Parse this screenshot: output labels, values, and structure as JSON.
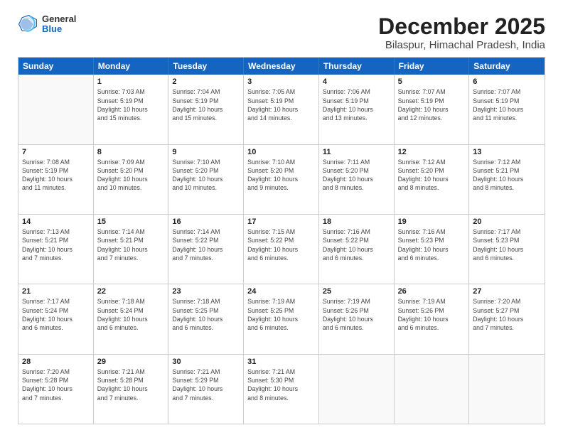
{
  "header": {
    "logo": {
      "general": "General",
      "blue": "Blue"
    },
    "title": "December 2025",
    "subtitle": "Bilaspur, Himachal Pradesh, India"
  },
  "calendar": {
    "days_of_week": [
      "Sunday",
      "Monday",
      "Tuesday",
      "Wednesday",
      "Thursday",
      "Friday",
      "Saturday"
    ],
    "rows": [
      [
        {
          "day": "",
          "info": ""
        },
        {
          "day": "1",
          "info": "Sunrise: 7:03 AM\nSunset: 5:19 PM\nDaylight: 10 hours\nand 15 minutes."
        },
        {
          "day": "2",
          "info": "Sunrise: 7:04 AM\nSunset: 5:19 PM\nDaylight: 10 hours\nand 15 minutes."
        },
        {
          "day": "3",
          "info": "Sunrise: 7:05 AM\nSunset: 5:19 PM\nDaylight: 10 hours\nand 14 minutes."
        },
        {
          "day": "4",
          "info": "Sunrise: 7:06 AM\nSunset: 5:19 PM\nDaylight: 10 hours\nand 13 minutes."
        },
        {
          "day": "5",
          "info": "Sunrise: 7:07 AM\nSunset: 5:19 PM\nDaylight: 10 hours\nand 12 minutes."
        },
        {
          "day": "6",
          "info": "Sunrise: 7:07 AM\nSunset: 5:19 PM\nDaylight: 10 hours\nand 11 minutes."
        }
      ],
      [
        {
          "day": "7",
          "info": "Sunrise: 7:08 AM\nSunset: 5:19 PM\nDaylight: 10 hours\nand 11 minutes."
        },
        {
          "day": "8",
          "info": "Sunrise: 7:09 AM\nSunset: 5:20 PM\nDaylight: 10 hours\nand 10 minutes."
        },
        {
          "day": "9",
          "info": "Sunrise: 7:10 AM\nSunset: 5:20 PM\nDaylight: 10 hours\nand 10 minutes."
        },
        {
          "day": "10",
          "info": "Sunrise: 7:10 AM\nSunset: 5:20 PM\nDaylight: 10 hours\nand 9 minutes."
        },
        {
          "day": "11",
          "info": "Sunrise: 7:11 AM\nSunset: 5:20 PM\nDaylight: 10 hours\nand 8 minutes."
        },
        {
          "day": "12",
          "info": "Sunrise: 7:12 AM\nSunset: 5:20 PM\nDaylight: 10 hours\nand 8 minutes."
        },
        {
          "day": "13",
          "info": "Sunrise: 7:12 AM\nSunset: 5:21 PM\nDaylight: 10 hours\nand 8 minutes."
        }
      ],
      [
        {
          "day": "14",
          "info": "Sunrise: 7:13 AM\nSunset: 5:21 PM\nDaylight: 10 hours\nand 7 minutes."
        },
        {
          "day": "15",
          "info": "Sunrise: 7:14 AM\nSunset: 5:21 PM\nDaylight: 10 hours\nand 7 minutes."
        },
        {
          "day": "16",
          "info": "Sunrise: 7:14 AM\nSunset: 5:22 PM\nDaylight: 10 hours\nand 7 minutes."
        },
        {
          "day": "17",
          "info": "Sunrise: 7:15 AM\nSunset: 5:22 PM\nDaylight: 10 hours\nand 6 minutes."
        },
        {
          "day": "18",
          "info": "Sunrise: 7:16 AM\nSunset: 5:22 PM\nDaylight: 10 hours\nand 6 minutes."
        },
        {
          "day": "19",
          "info": "Sunrise: 7:16 AM\nSunset: 5:23 PM\nDaylight: 10 hours\nand 6 minutes."
        },
        {
          "day": "20",
          "info": "Sunrise: 7:17 AM\nSunset: 5:23 PM\nDaylight: 10 hours\nand 6 minutes."
        }
      ],
      [
        {
          "day": "21",
          "info": "Sunrise: 7:17 AM\nSunset: 5:24 PM\nDaylight: 10 hours\nand 6 minutes."
        },
        {
          "day": "22",
          "info": "Sunrise: 7:18 AM\nSunset: 5:24 PM\nDaylight: 10 hours\nand 6 minutes."
        },
        {
          "day": "23",
          "info": "Sunrise: 7:18 AM\nSunset: 5:25 PM\nDaylight: 10 hours\nand 6 minutes."
        },
        {
          "day": "24",
          "info": "Sunrise: 7:19 AM\nSunset: 5:25 PM\nDaylight: 10 hours\nand 6 minutes."
        },
        {
          "day": "25",
          "info": "Sunrise: 7:19 AM\nSunset: 5:26 PM\nDaylight: 10 hours\nand 6 minutes."
        },
        {
          "day": "26",
          "info": "Sunrise: 7:19 AM\nSunset: 5:26 PM\nDaylight: 10 hours\nand 6 minutes."
        },
        {
          "day": "27",
          "info": "Sunrise: 7:20 AM\nSunset: 5:27 PM\nDaylight: 10 hours\nand 7 minutes."
        }
      ],
      [
        {
          "day": "28",
          "info": "Sunrise: 7:20 AM\nSunset: 5:28 PM\nDaylight: 10 hours\nand 7 minutes."
        },
        {
          "day": "29",
          "info": "Sunrise: 7:21 AM\nSunset: 5:28 PM\nDaylight: 10 hours\nand 7 minutes."
        },
        {
          "day": "30",
          "info": "Sunrise: 7:21 AM\nSunset: 5:29 PM\nDaylight: 10 hours\nand 7 minutes."
        },
        {
          "day": "31",
          "info": "Sunrise: 7:21 AM\nSunset: 5:30 PM\nDaylight: 10 hours\nand 8 minutes."
        },
        {
          "day": "",
          "info": ""
        },
        {
          "day": "",
          "info": ""
        },
        {
          "day": "",
          "info": ""
        }
      ]
    ]
  }
}
